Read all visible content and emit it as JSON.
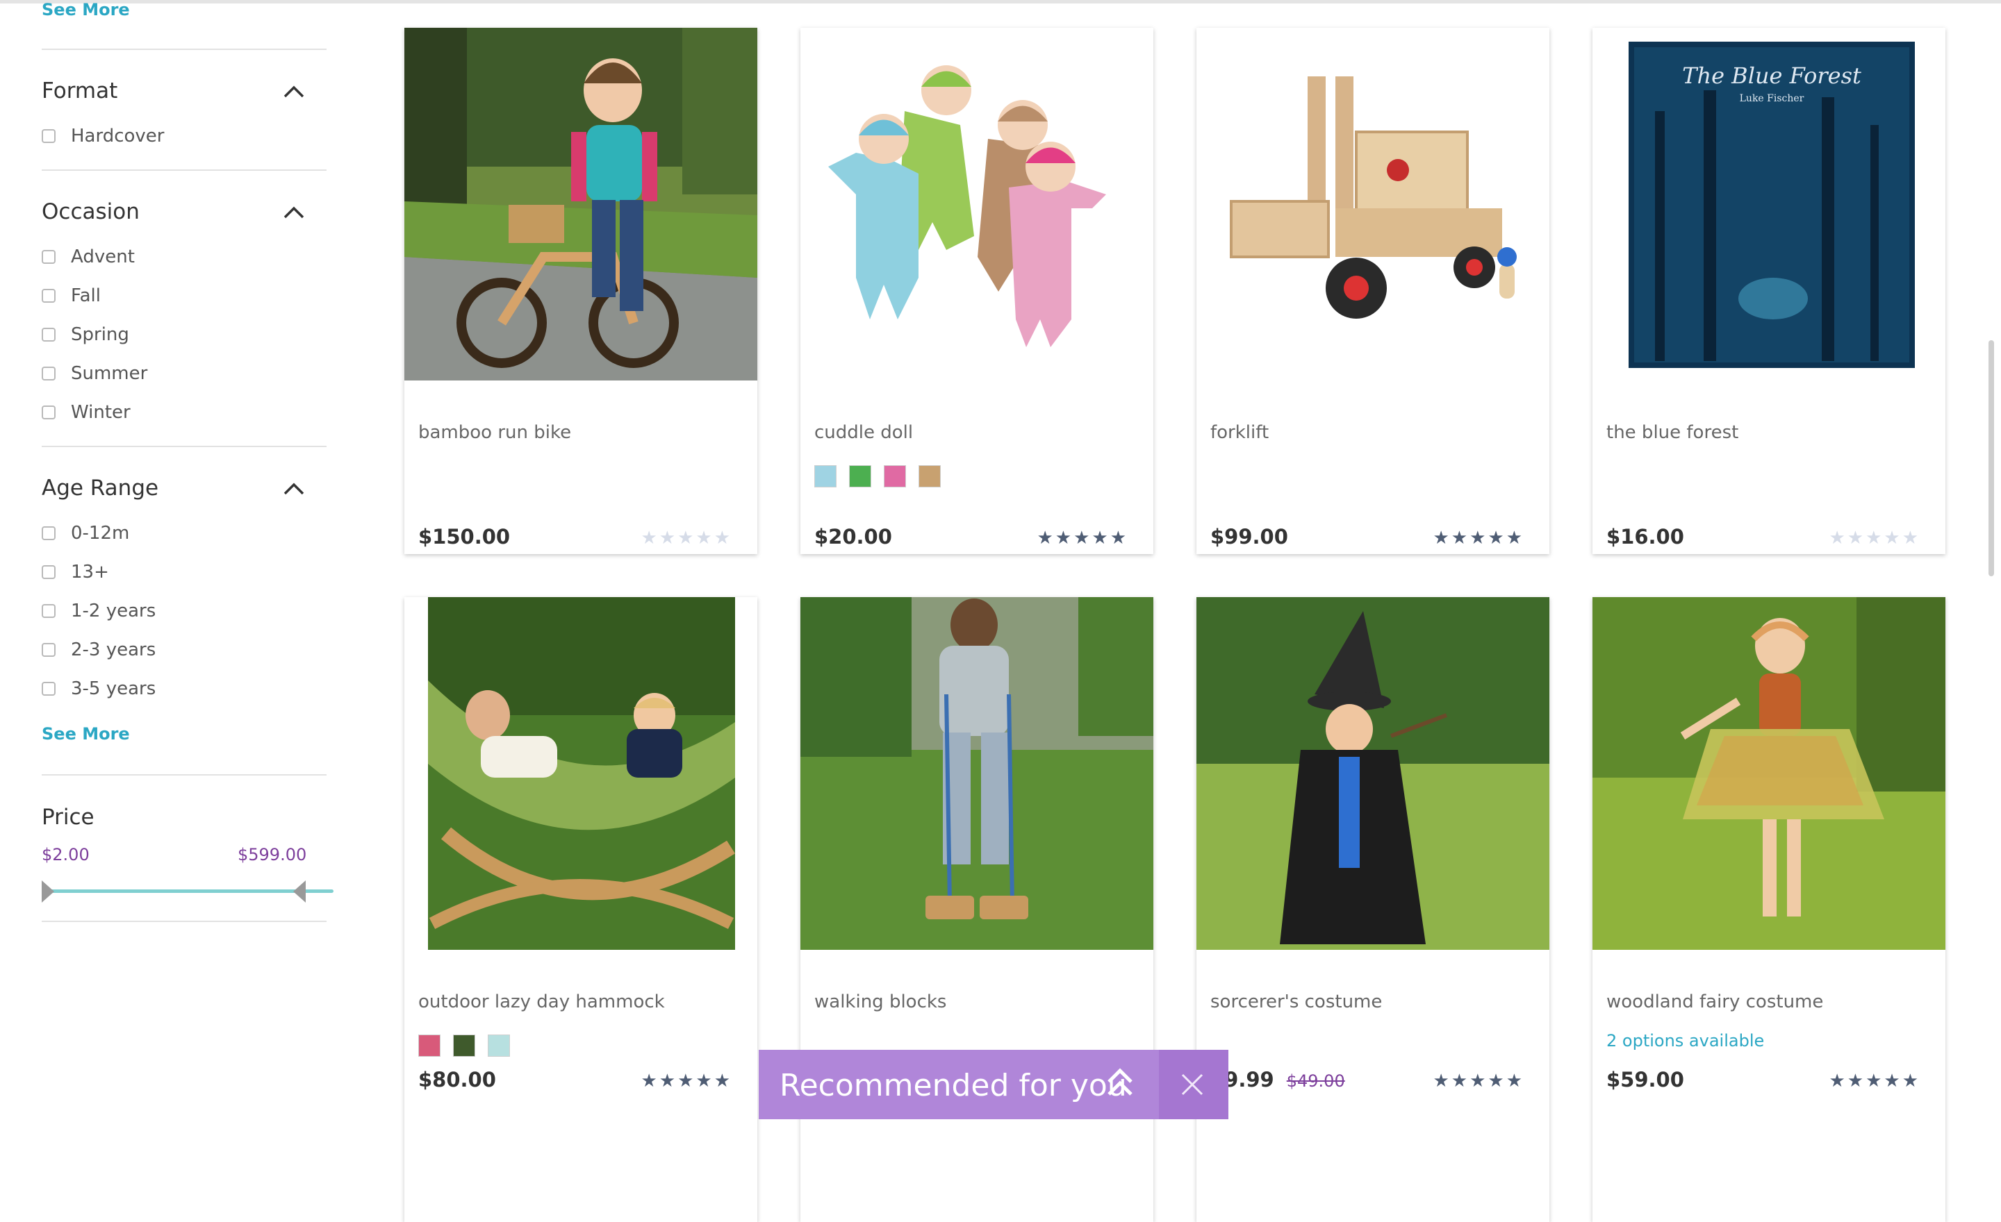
{
  "sidebar": {
    "see_more_top": "See More",
    "format": {
      "title": "Format",
      "options": [
        "Hardcover"
      ]
    },
    "occasion": {
      "title": "Occasion",
      "options": [
        "Advent",
        "Fall",
        "Spring",
        "Summer",
        "Winter"
      ]
    },
    "age_range": {
      "title": "Age Range",
      "options": [
        "0-12m",
        "13+",
        "1-2 years",
        "2-3 years",
        "3-5 years"
      ],
      "see_more": "See More"
    },
    "price": {
      "title": "Price",
      "min": "$2.00",
      "max": "$599.00",
      "range_low": 2,
      "range_high": 599
    }
  },
  "products": [
    {
      "name": "bamboo run bike",
      "price": "$150.00",
      "rating": 0
    },
    {
      "name": "cuddle doll",
      "price": "$20.00",
      "rating": 5,
      "swatches": [
        "#9fd3e3",
        "#4caf50",
        "#e06aa3",
        "#c8a170"
      ]
    },
    {
      "name": "forklift",
      "price": "$99.00",
      "rating": 5
    },
    {
      "name": "the blue forest",
      "price": "$16.00",
      "rating": 0,
      "book_title": "The Blue Forest",
      "book_author": "Luke Fischer"
    },
    {
      "name": "outdoor lazy day hammock",
      "price": "$80.00",
      "rating": 5,
      "swatches": [
        "#d85a7a",
        "#3f5a2c",
        "#b7e0e0"
      ]
    },
    {
      "name": "walking blocks",
      "price": "",
      "rating": 0
    },
    {
      "name": "sorcerer's costume",
      "price": "39.99",
      "old_price": "$49.00",
      "rating": 5
    },
    {
      "name": "woodland fairy costume",
      "price": "$59.00",
      "rating": 5,
      "options": "2 options available"
    }
  ],
  "recommended": {
    "label": "Recommended for you"
  },
  "colors": {
    "accent_purple": "#b086d9",
    "link_teal": "#2ba7c4",
    "price_purple": "#7d3f9c",
    "star_filled": "#4f5d74",
    "star_empty": "#d6dce8"
  }
}
